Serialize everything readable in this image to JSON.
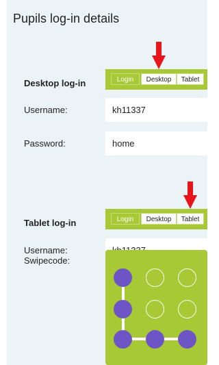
{
  "page_title": "Pupils log-in details",
  "desktop": {
    "heading": "Desktop log-in",
    "tabs": {
      "login": "Login",
      "desktop": "Desktop",
      "tablet": "Tablet"
    },
    "username_label": "Username:",
    "username_value": "kh11337",
    "password_label": "Password:",
    "password_value": "home"
  },
  "tablet": {
    "heading": "Tablet log-in",
    "tabs": {
      "login": "Login",
      "desktop": "Desktop",
      "tablet": "Tablet"
    },
    "username_label": "Username:",
    "username_value": "kh11337",
    "swipecode_label": "Swipecode:"
  },
  "colors": {
    "accent_green": "#a6c935",
    "swipe_dot": "#6e55c5",
    "arrow": "#e8141b",
    "panel_bg": "#ecf3f7"
  },
  "icons": [
    "arrow-down-icon"
  ]
}
